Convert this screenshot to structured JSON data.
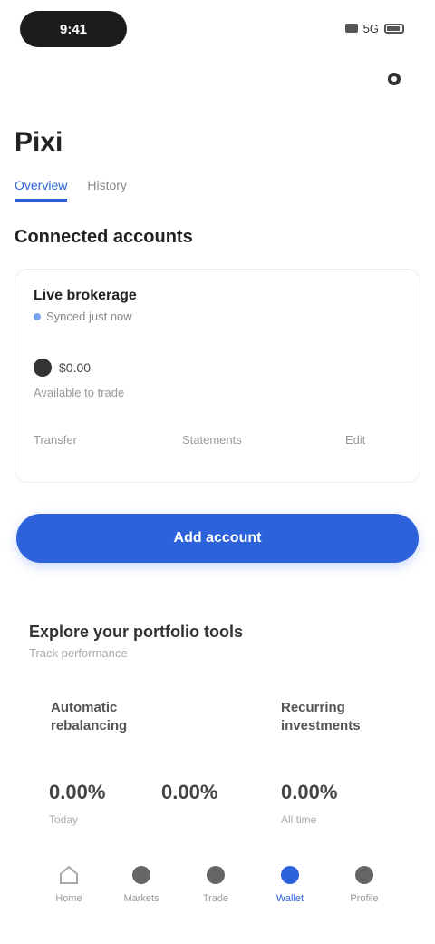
{
  "status_bar": {
    "time": "9:41",
    "network": "5G"
  },
  "header": {
    "title": "Pixi"
  },
  "tabs": [
    {
      "label": "Overview"
    },
    {
      "label": "History"
    }
  ],
  "section": {
    "title": "Connected accounts"
  },
  "account": {
    "name": "Live brokerage",
    "subtitle": "Synced just now",
    "balance": "$0.00",
    "balance_sub": "Available to trade"
  },
  "card_actions": [
    {
      "top": "",
      "label": "Transfer"
    },
    {
      "top": "",
      "label": "Statements"
    },
    {
      "top": "",
      "label": "Edit"
    }
  ],
  "primary_button": {
    "label": "Add account"
  },
  "promo": {
    "title": "Explore your portfolio tools",
    "subtitle": "Track performance"
  },
  "features": [
    {
      "label": "Automatic rebalancing"
    },
    {
      "label": "Recurring investments"
    }
  ],
  "stats": [
    {
      "value": "0.00%",
      "label": "Today"
    },
    {
      "value": "0.00%",
      "label": ""
    },
    {
      "value": "0.00%",
      "label": "All time"
    }
  ],
  "nav": [
    {
      "label": "Home",
      "icon": "home-icon"
    },
    {
      "label": "Markets",
      "icon": "chart-icon"
    },
    {
      "label": "Trade",
      "icon": "swap-icon"
    },
    {
      "label": "Wallet",
      "icon": "wallet-icon"
    },
    {
      "label": "Profile",
      "icon": "user-icon"
    }
  ],
  "colors": {
    "accent": "#2c63db",
    "text": "#1f1f1f",
    "muted": "#999999"
  }
}
